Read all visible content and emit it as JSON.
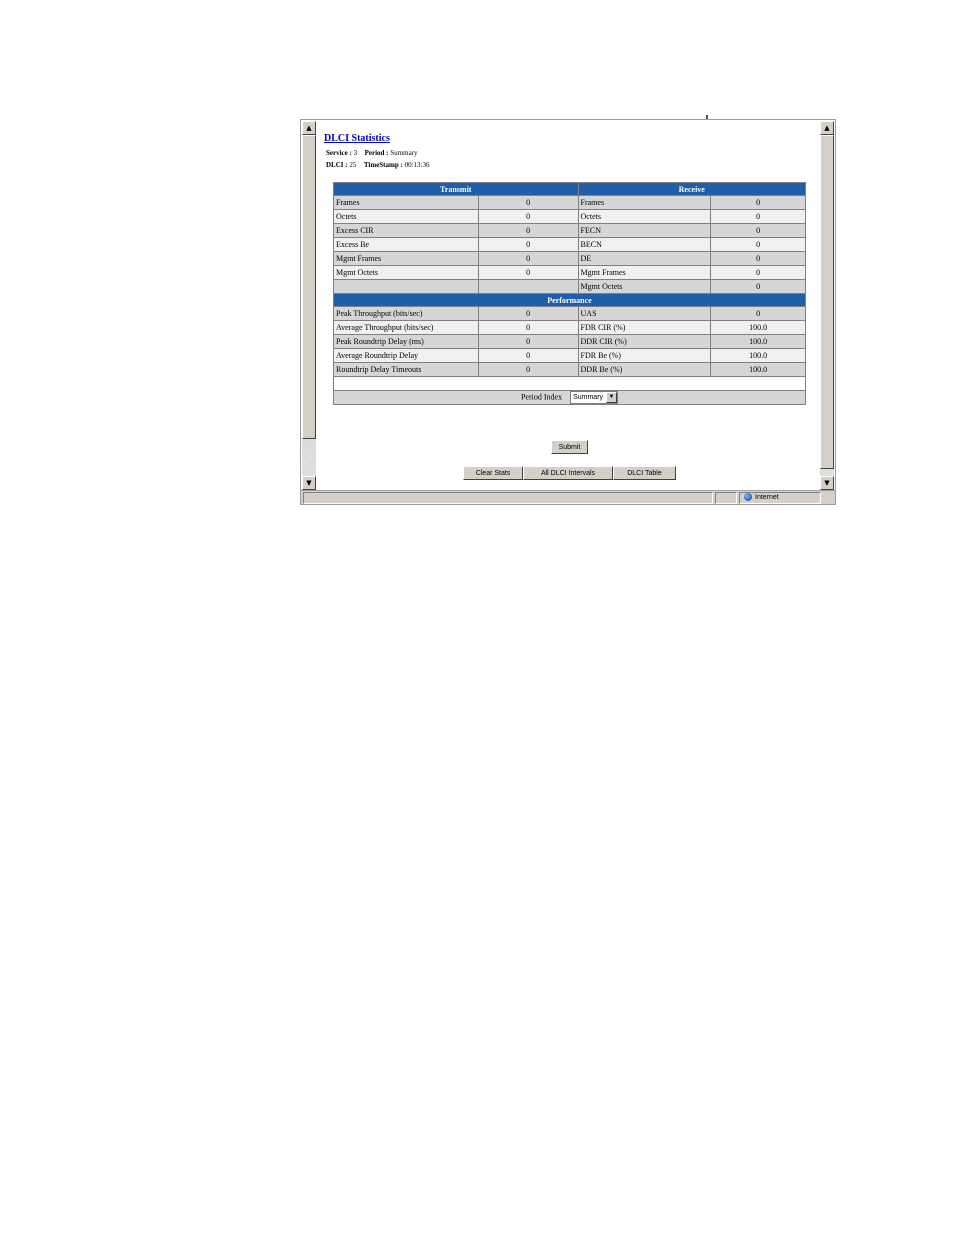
{
  "page": {
    "title": "DLCI Statistics",
    "service_label": "Service :",
    "service_value": "3",
    "period_label": "Period :",
    "period_value": "Summary",
    "dlci_label": "DLCI :",
    "dlci_value": "25",
    "timestamp_label": "TimeStamp :",
    "timestamp_value": "00:13:36"
  },
  "table": {
    "transmit_header": "Transmit",
    "receive_header": "Receive",
    "performance_header": "Performance",
    "traffic_rows": [
      {
        "tx_label": "Frames",
        "tx_value": "0",
        "rx_label": "Frames",
        "rx_value": "0"
      },
      {
        "tx_label": "Octets",
        "tx_value": "0",
        "rx_label": "Octets",
        "rx_value": "0"
      },
      {
        "tx_label": "Excess CIR",
        "tx_value": "0",
        "rx_label": "FECN",
        "rx_value": "0"
      },
      {
        "tx_label": "Excess Be",
        "tx_value": "0",
        "rx_label": "BECN",
        "rx_value": "0"
      },
      {
        "tx_label": "Mgmt Frames",
        "tx_value": "0",
        "rx_label": "DE",
        "rx_value": "0"
      },
      {
        "tx_label": "Mgmt Octets",
        "tx_value": "0",
        "rx_label": "Mgmt Frames",
        "rx_value": "0"
      },
      {
        "tx_label": "",
        "tx_value": "",
        "rx_label": "Mgmt Octets",
        "rx_value": "0"
      }
    ],
    "performance_rows": [
      {
        "l_label": "Peak Throughput (bits/sec)",
        "l_value": "0",
        "r_label": "UAS",
        "r_value": "0"
      },
      {
        "l_label": "Average Throughput (bits/sec)",
        "l_value": "0",
        "r_label": "FDR CIR (%)",
        "r_value": "100.0"
      },
      {
        "l_label": "Peak Roundtrip  Delay (ms)",
        "l_value": "0",
        "r_label": "DDR CIR (%)",
        "r_value": "100.0"
      },
      {
        "l_label": "Average Roundtrip Delay",
        "l_value": "0",
        "r_label": "FDR Be (%)",
        "r_value": "100.0"
      },
      {
        "l_label": "Roundtrip Delay Timeouts",
        "l_value": "0",
        "r_label": "DDR Be (%)",
        "r_value": "100.0"
      }
    ],
    "period_index_label": "Period Index",
    "period_index_selected": "Summary"
  },
  "buttons": {
    "submit": "Submit",
    "clear_stats": "Clear Stats",
    "all_dlci_intervals": "All DLCI Intervals",
    "dlci_table": "DLCI Table"
  },
  "statusbar": {
    "zone": "Internet"
  },
  "icons": {
    "scroll_up": "scroll-up-arrow-icon",
    "scroll_down": "scroll-down-arrow-icon",
    "dropdown": "chevron-down-icon",
    "zone": "globe-icon"
  },
  "colors": {
    "header_blue": "#1f5ea8",
    "link_blue": "#0000cc",
    "shaded_row": "#d6d6d6",
    "light_row": "#f0f0f0"
  }
}
